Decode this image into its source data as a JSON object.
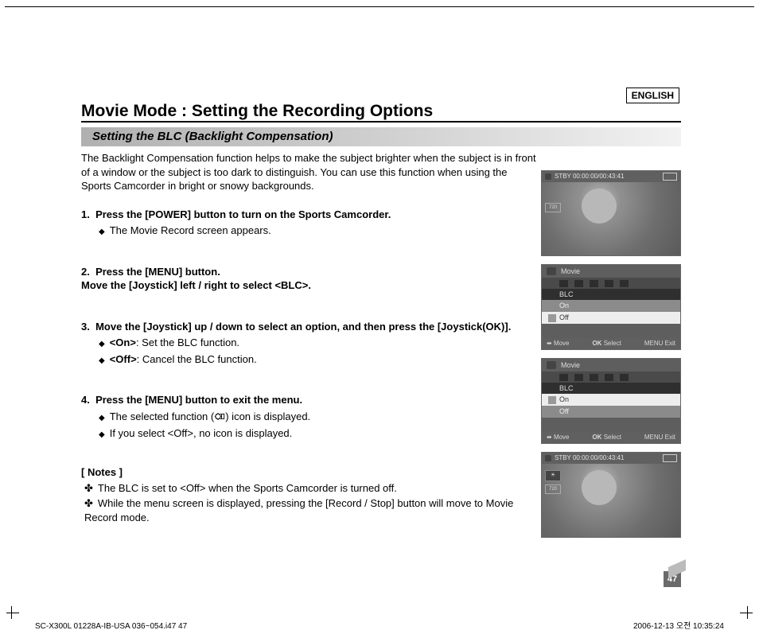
{
  "language_label": "ENGLISH",
  "page_title": "Movie Mode : Setting the Recording Options",
  "subtitle": "Setting the BLC (Backlight Compensation)",
  "intro": "The Backlight Compensation function helps to make the subject brighter when the subject is in front of a window or the subject is too dark to distinguish. You can use this function when using the Sports Camcorder in bright or snowy backgrounds.",
  "steps": [
    {
      "num": "1.",
      "head": "Press the [POWER] button to turn on the Sports Camcorder.",
      "subs": [
        "The Movie Record screen appears."
      ]
    },
    {
      "num": "2.",
      "head": "Press the [MENU] button.\nMove the [Joystick] left / right to select <BLC>.",
      "subs": []
    },
    {
      "num": "3.",
      "head": "Move the [Joystick] up / down to select an option, and then press the [Joystick(OK)].",
      "subs": [
        {
          "bold": "<On>",
          "rest": ": Set the BLC function."
        },
        {
          "bold": "<Off>",
          "rest": ": Cancel the BLC function."
        }
      ]
    },
    {
      "num": "4.",
      "head": "Press the [MENU] button to exit the menu.",
      "subs": [
        "The selected function (   ) icon is displayed.",
        "If you select <Off>, no icon is displayed."
      ]
    }
  ],
  "notes_header": "[ Notes ]",
  "notes": [
    "The BLC is set to <Off> when the Sports Camcorder is turned off.",
    "While the menu screen is displayed, pressing the [Record / Stop] button will move to Movie Record mode."
  ],
  "figs": {
    "f1": {
      "num": "1",
      "top": "STBY 00:00:00/00:43:41",
      "res": "720"
    },
    "f2": {
      "num": "2",
      "mode": "Movie",
      "label": "BLC",
      "optA": "On",
      "optB": "Off",
      "move": "Move",
      "select": "Select",
      "exit": "Exit"
    },
    "f3": {
      "num": "3",
      "mode": "Movie",
      "label": "BLC",
      "optA": "On",
      "optB": "Off",
      "move": "Move",
      "select": "Select",
      "exit": "Exit"
    },
    "f4": {
      "num": "4",
      "top": "STBY 00:00:00/00:43:41",
      "res": "720"
    }
  },
  "page_number": "47",
  "footer_left": "SC-X300L 01228A-IB-USA 036~054.i47   47",
  "footer_right": "2006-12-13   오전 10:35:24"
}
